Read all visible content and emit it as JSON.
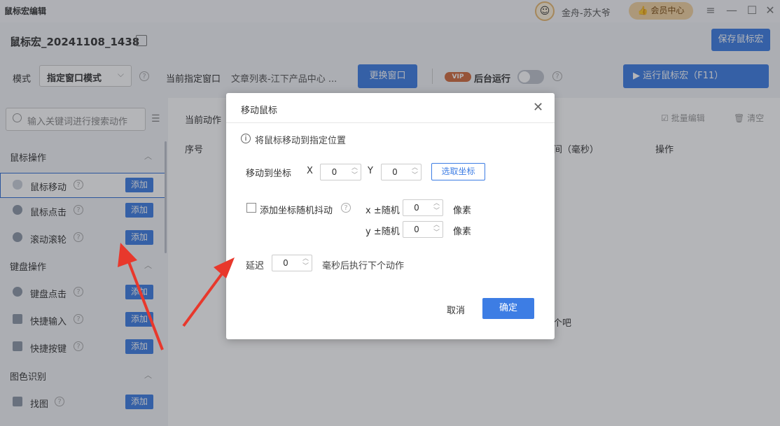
{
  "titlebar": {
    "app_title": "鼠标宏编辑",
    "user_name": "金舟-苏大爷",
    "vip_center": "会员中心"
  },
  "header": {
    "macro_name": "鼠标宏_20241108_1438",
    "save_label": "保存鼠标宏"
  },
  "mode_row": {
    "mode_label": "模式",
    "mode_value": "指定窗口模式",
    "current_window_label": "当前指定窗口",
    "current_window_value": "文章列表-江下产品中心 ...",
    "change_window_label": "更换窗口",
    "vip_badge": "VIP",
    "background_run_label": "后台运行",
    "run_label": "▶ 运行鼠标宏（F11）"
  },
  "sidebar": {
    "search_placeholder": "输入关键词进行搜索动作",
    "add_label": "添加",
    "categories": [
      {
        "name": "鼠标操作",
        "items": [
          "鼠标移动",
          "鼠标点击",
          "滚动滚轮"
        ]
      },
      {
        "name": "键盘操作",
        "items": [
          "键盘点击",
          "快捷输入",
          "快捷按键"
        ]
      },
      {
        "name": "图色识别",
        "items": [
          "找图"
        ]
      }
    ]
  },
  "main": {
    "current_action_tab": "当前动作",
    "batch_edit": "批量编辑",
    "clear": "清空",
    "columns": {
      "seq": "序号",
      "time": "间（毫秒）",
      "op": "操作"
    },
    "empty_text": "个吧"
  },
  "dialog": {
    "title": "移动鼠标",
    "info": "将鼠标移动到指定位置",
    "move_to_label": "移动到坐标",
    "x_label": "X",
    "x_value": "0",
    "y_label": "Y",
    "y_value": "0",
    "pick_coord": "选取坐标",
    "jitter_label": "添加坐标随机抖动",
    "x_random_label": "x ±随机",
    "x_random_value": "0",
    "y_random_label": "y ±随机",
    "y_random_value": "0",
    "unit_pixel": "像素",
    "delay_label": "延迟",
    "delay_value": "0",
    "delay_after": "毫秒后执行下个动作",
    "cancel": "取消",
    "ok": "确定"
  },
  "colors": {
    "accent": "#3d7de4",
    "vip": "#f3d3a0",
    "arrow": "#e8382c"
  }
}
